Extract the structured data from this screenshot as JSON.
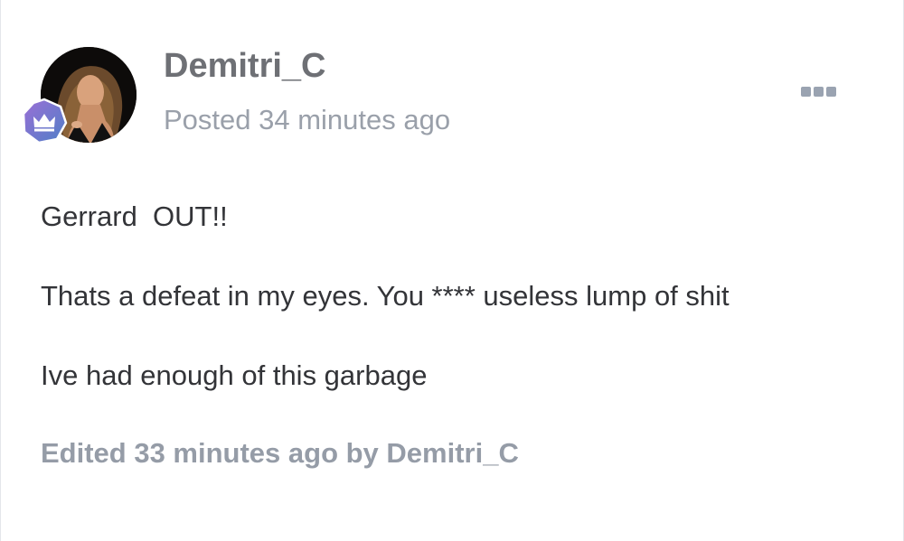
{
  "post": {
    "author": {
      "name": "Demitri_C",
      "avatar": "profile-photo",
      "rank_badge": "crown-badge-icon"
    },
    "posted_time": "Posted 34 minutes ago",
    "more_options_icon": "more-options-icon",
    "body": [
      "Gerrard  OUT!!",
      "Thats a defeat in my eyes. You **** useless lump of shit",
      "Ive had enough of this garbage"
    ],
    "edit_notice": "Edited 33 minutes ago by Demitri_C"
  },
  "colors": {
    "author_name": "#6e7075",
    "meta_text": "#9aa0aa",
    "body_text": "#333438",
    "edit_notice": "#959ca7",
    "badge_gradient_start": "#9b6fd6",
    "badge_gradient_end": "#4f7fc7"
  }
}
